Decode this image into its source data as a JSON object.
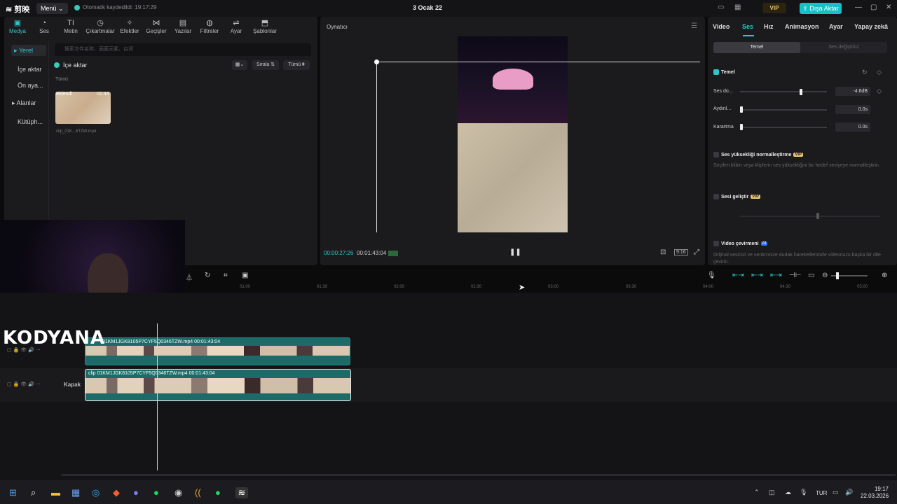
{
  "titlebar": {
    "logo": "≋ 剪映",
    "menu": "Menü ⌄",
    "autosave": "Otomatik kaydedildi: 19:17:29",
    "project": "3 Ocak 22",
    "vip": "VIP",
    "export": "⇪ Dışa Aktar"
  },
  "media": {
    "tabs": [
      {
        "icon": "▣",
        "label": "Medya"
      },
      {
        "icon": "◔",
        "label": "Ses"
      },
      {
        "icon": "TI",
        "label": "Metin"
      },
      {
        "icon": "◷",
        "label": "Çıkartmalar"
      },
      {
        "icon": "✧",
        "label": "Efektler"
      },
      {
        "icon": "⋈",
        "label": "Geçişler"
      },
      {
        "icon": "▤",
        "label": "Yazılar"
      },
      {
        "icon": "◍",
        "label": "Filtreler"
      },
      {
        "icon": "⇌",
        "label": "Ayar"
      },
      {
        "icon": "⬒",
        "label": "Şablonlar"
      }
    ],
    "side": {
      "local": "▸ Yerel",
      "import": "İçe aktar",
      "presets": "Ön aya...",
      "spaces": "▸ Alanlar",
      "library": "Kütüph..."
    },
    "search_placeholder": "搜索文件名称、画面元素、台词",
    "import_label": "İçe aktar",
    "sort_label": "Sırala ⇅",
    "all_label": "Tümü ⩩",
    "all_section": "Tümü",
    "thumb": {
      "added": "Eklendi",
      "duration": "01:44",
      "name": "clip_01K...6TZW.mp4"
    }
  },
  "player": {
    "title": "Oynatıcı",
    "current_time": "00:00:27:26",
    "total_time": "00:01:43:04",
    "ratio": "9:16"
  },
  "props": {
    "tabs": [
      "Video",
      "Ses",
      "Hız",
      "Animasyon",
      "Ayar",
      "Yapay zekâ"
    ],
    "active_tab": "Ses",
    "seg_basic": "Temel",
    "seg_voice": "Ses değiştirici",
    "basic_label": "Temel",
    "volume_label": "Ses dü...",
    "volume_value": "-4.6dB",
    "volume_level": 0.85,
    "fadein_label": "Aydınl...",
    "fadein_value": "0.0s",
    "fadeout_label": "Karartma",
    "fadeout_value": "0.0s",
    "normalize_label": "Ses yüksekliği normalleştirme",
    "normalize_desc": "Seçilen klibin veya kliplerin ses yüksekliğini bir hedef seviyeye normalleştirin.",
    "enhance_label": "Sesi geliştir",
    "lipsync_label": "Video çevirmeni",
    "ai_badge": "AI",
    "lipsync_desc": "Orijinal sesinizi ve senkronize dudak hareketlerinizle videonuzu başka bir dile çevirin.",
    "vip_badge": "VIP"
  },
  "timeline": {
    "ruler": [
      "01:00",
      "01:30",
      "02:00",
      "02:30",
      "03:00",
      "03:30",
      "04:00",
      "04:30",
      "05:00"
    ],
    "clip_top": "01KM1JGK8105P7CYF5Q0346TZW.mp4  00:01:43:04",
    "clip_main": "clip 01KM1JGK8105P7CYF5Q0346TZW.mp4  00:01:43:04",
    "cover": "Kapak",
    "overlay_text": "KODYANA"
  },
  "taskbar": {
    "lang": "TUR",
    "time": "19:17",
    "date": "22.03.2026"
  },
  "colors": {
    "accent": "#2ec6c8",
    "panel": "#1b1b1e",
    "export": "#16c0c7"
  }
}
